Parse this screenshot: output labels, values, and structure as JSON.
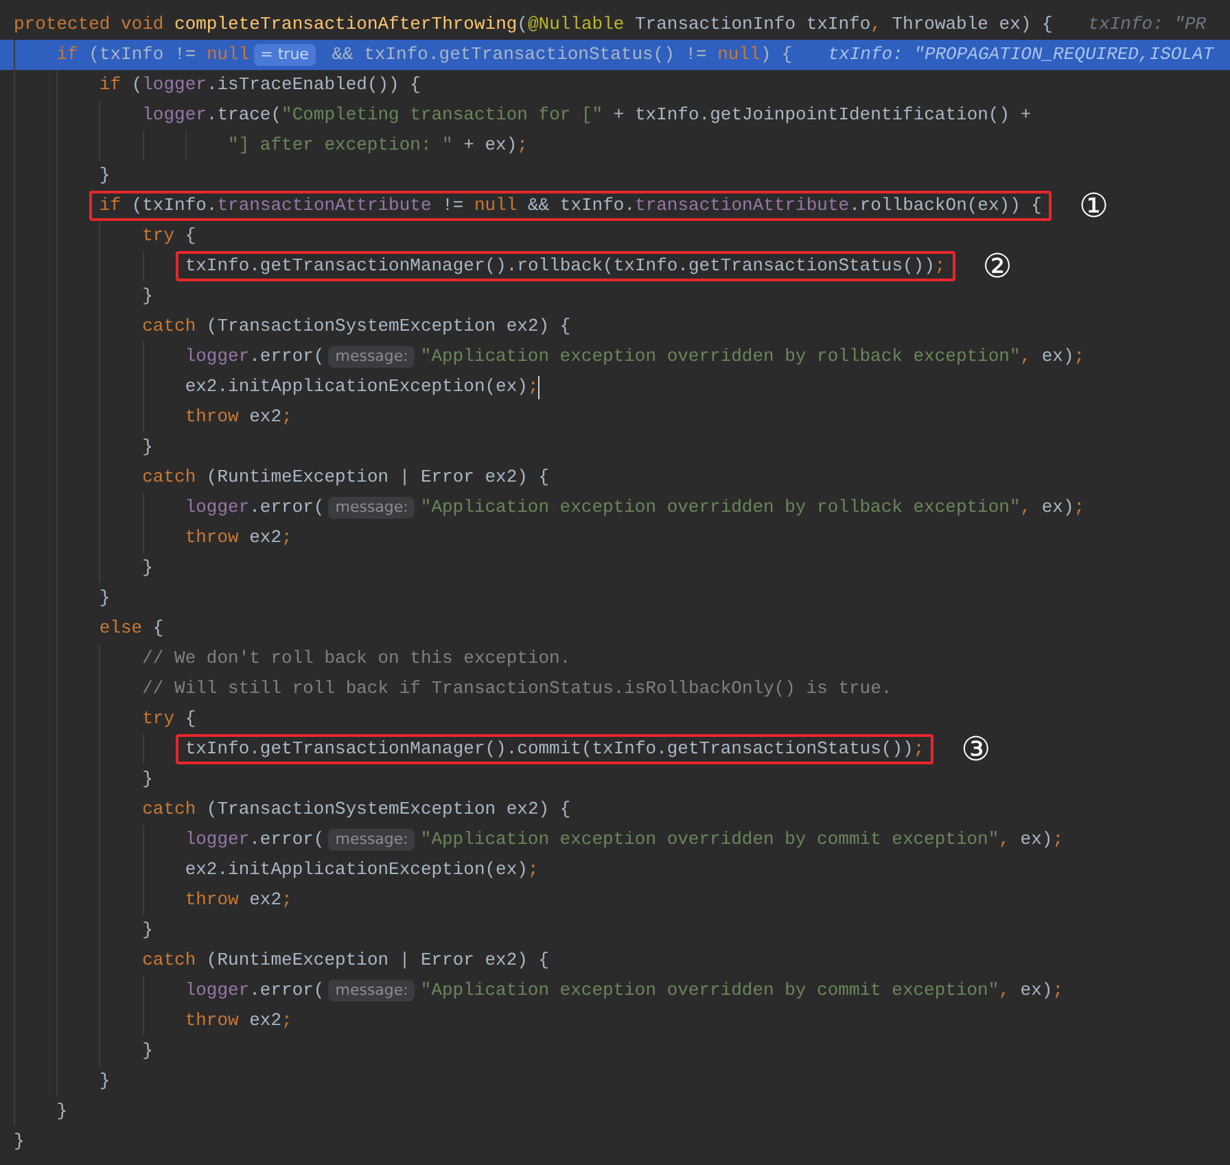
{
  "editor": {
    "lines": [
      {
        "selected": false,
        "caret": false,
        "tokens": [
          {
            "kind": "kw",
            "text": "protected void "
          },
          {
            "kind": "decl",
            "text": "completeTransactionAfterThrowing"
          },
          {
            "kind": "id",
            "text": "("
          },
          {
            "kind": "ann",
            "text": "@Nullable"
          },
          {
            "kind": "id",
            "text": " TransactionInfo txInfo"
          },
          {
            "kind": "kw",
            "text": ","
          },
          {
            "kind": "id",
            "text": " Throwable ex) {"
          },
          {
            "kind": "value",
            "text": "txInfo: \"PR"
          }
        ]
      },
      {
        "selected": true,
        "caret": false,
        "tokens": [
          {
            "kind": "kw",
            "text": "    if "
          },
          {
            "kind": "id",
            "text": "(txInfo != "
          },
          {
            "kind": "kw",
            "text": "null"
          },
          {
            "kind": "hint",
            "text": "= true"
          },
          {
            "kind": "id",
            "text": " && txInfo.getTransactionStatus() != "
          },
          {
            "kind": "kw",
            "text": "null"
          },
          {
            "kind": "id",
            "text": ") {"
          },
          {
            "kind": "value",
            "text": "txInfo: \"PROPAGATION_REQUIRED,ISOLAT"
          }
        ]
      },
      {
        "selected": false,
        "caret": false,
        "tokens": [
          {
            "kind": "kw",
            "text": "        if "
          },
          {
            "kind": "id",
            "text": "("
          },
          {
            "kind": "field",
            "text": "logger"
          },
          {
            "kind": "id",
            "text": ".isTraceEnabled()) {"
          }
        ]
      },
      {
        "selected": false,
        "caret": false,
        "tokens": [
          {
            "kind": "field",
            "text": "            logger"
          },
          {
            "kind": "id",
            "text": ".trace("
          },
          {
            "kind": "str",
            "text": "\"Completing transaction for [\""
          },
          {
            "kind": "id",
            "text": " + txInfo.getJoinpointIdentification() +"
          }
        ]
      },
      {
        "selected": false,
        "caret": false,
        "tokens": [
          {
            "kind": "str",
            "text": "                    \"] after exception: \""
          },
          {
            "kind": "id",
            "text": " + ex)"
          },
          {
            "kind": "kw",
            "text": ";"
          }
        ]
      },
      {
        "selected": false,
        "caret": false,
        "tokens": [
          {
            "kind": "id",
            "text": "        }"
          }
        ]
      },
      {
        "selected": false,
        "caret": false,
        "annotation": "①",
        "tokens": [
          {
            "kind": "kw",
            "text": "        if "
          },
          {
            "kind": "id",
            "text": "(txInfo."
          },
          {
            "kind": "field",
            "text": "transactionAttribute"
          },
          {
            "kind": "id",
            "text": " != "
          },
          {
            "kind": "kw",
            "text": "null"
          },
          {
            "kind": "id",
            "text": " && txInfo."
          },
          {
            "kind": "field",
            "text": "transactionAttribute"
          },
          {
            "kind": "id",
            "text": ".rollbackOn(ex)) {"
          }
        ]
      },
      {
        "selected": false,
        "caret": false,
        "tokens": [
          {
            "kind": "kw",
            "text": "            try "
          },
          {
            "kind": "id",
            "text": "{"
          }
        ]
      },
      {
        "selected": false,
        "caret": false,
        "annotation": "②",
        "tokens": [
          {
            "kind": "id",
            "text": "                txInfo.getTransactionManager().rollback(txInfo.getTransactionStatus())"
          },
          {
            "kind": "kw",
            "text": ";"
          }
        ]
      },
      {
        "selected": false,
        "caret": false,
        "tokens": [
          {
            "kind": "id",
            "text": "            }"
          }
        ]
      },
      {
        "selected": false,
        "caret": false,
        "tokens": [
          {
            "kind": "kw",
            "text": "            catch "
          },
          {
            "kind": "id",
            "text": "(TransactionSystemException ex2) {"
          }
        ]
      },
      {
        "selected": false,
        "caret": false,
        "tokens": [
          {
            "kind": "field",
            "text": "                logger"
          },
          {
            "kind": "id",
            "text": ".error("
          },
          {
            "kind": "hint",
            "text": "message:"
          },
          {
            "kind": "str",
            "text": "\"Application exception overridden by rollback exception\""
          },
          {
            "kind": "kw",
            "text": ","
          },
          {
            "kind": "id",
            "text": " ex)"
          },
          {
            "kind": "kw",
            "text": ";"
          }
        ]
      },
      {
        "selected": false,
        "caret": true,
        "tokens": [
          {
            "kind": "id",
            "text": "                ex2.initApplicationException(ex)"
          },
          {
            "kind": "kw",
            "text": ";"
          }
        ]
      },
      {
        "selected": false,
        "caret": false,
        "tokens": [
          {
            "kind": "kw",
            "text": "                throw "
          },
          {
            "kind": "id",
            "text": "ex2"
          },
          {
            "kind": "kw",
            "text": ";"
          }
        ]
      },
      {
        "selected": false,
        "caret": false,
        "tokens": [
          {
            "kind": "id",
            "text": "            }"
          }
        ]
      },
      {
        "selected": false,
        "caret": false,
        "tokens": [
          {
            "kind": "kw",
            "text": "            catch "
          },
          {
            "kind": "id",
            "text": "(RuntimeException | Error ex2) {"
          }
        ]
      },
      {
        "selected": false,
        "caret": false,
        "tokens": [
          {
            "kind": "field",
            "text": "                logger"
          },
          {
            "kind": "id",
            "text": ".error("
          },
          {
            "kind": "hint",
            "text": "message:"
          },
          {
            "kind": "str",
            "text": "\"Application exception overridden by rollback exception\""
          },
          {
            "kind": "kw",
            "text": ","
          },
          {
            "kind": "id",
            "text": " ex)"
          },
          {
            "kind": "kw",
            "text": ";"
          }
        ]
      },
      {
        "selected": false,
        "caret": false,
        "tokens": [
          {
            "kind": "kw",
            "text": "                throw "
          },
          {
            "kind": "id",
            "text": "ex2"
          },
          {
            "kind": "kw",
            "text": ";"
          }
        ]
      },
      {
        "selected": false,
        "caret": false,
        "tokens": [
          {
            "kind": "id",
            "text": "            }"
          }
        ]
      },
      {
        "selected": false,
        "caret": false,
        "tokens": [
          {
            "kind": "id",
            "text": "        }"
          }
        ]
      },
      {
        "selected": false,
        "caret": false,
        "tokens": [
          {
            "kind": "kw",
            "text": "        else "
          },
          {
            "kind": "id",
            "text": "{"
          }
        ]
      },
      {
        "selected": false,
        "caret": false,
        "tokens": [
          {
            "kind": "comment",
            "text": "            // We don't roll back on this exception."
          }
        ]
      },
      {
        "selected": false,
        "caret": false,
        "tokens": [
          {
            "kind": "comment",
            "text": "            // Will still roll back if TransactionStatus.isRollbackOnly() is true."
          }
        ]
      },
      {
        "selected": false,
        "caret": false,
        "tokens": [
          {
            "kind": "kw",
            "text": "            try "
          },
          {
            "kind": "id",
            "text": "{"
          }
        ]
      },
      {
        "selected": false,
        "caret": false,
        "annotation": "③",
        "tokens": [
          {
            "kind": "id",
            "text": "                txInfo.getTransactionManager().commit(txInfo.getTransactionStatus())"
          },
          {
            "kind": "kw",
            "text": ";"
          }
        ]
      },
      {
        "selected": false,
        "caret": false,
        "tokens": [
          {
            "kind": "id",
            "text": "            }"
          }
        ]
      },
      {
        "selected": false,
        "caret": false,
        "tokens": [
          {
            "kind": "kw",
            "text": "            catch "
          },
          {
            "kind": "id",
            "text": "(TransactionSystemException ex2) {"
          }
        ]
      },
      {
        "selected": false,
        "caret": false,
        "tokens": [
          {
            "kind": "field",
            "text": "                logger"
          },
          {
            "kind": "id",
            "text": ".error("
          },
          {
            "kind": "hint",
            "text": "message:"
          },
          {
            "kind": "str",
            "text": "\"Application exception overridden by commit exception\""
          },
          {
            "kind": "kw",
            "text": ","
          },
          {
            "kind": "id",
            "text": " ex)"
          },
          {
            "kind": "kw",
            "text": ";"
          }
        ]
      },
      {
        "selected": false,
        "caret": false,
        "tokens": [
          {
            "kind": "id",
            "text": "                ex2.initApplicationException(ex)"
          },
          {
            "kind": "kw",
            "text": ";"
          }
        ]
      },
      {
        "selected": false,
        "caret": false,
        "tokens": [
          {
            "kind": "kw",
            "text": "                throw "
          },
          {
            "kind": "id",
            "text": "ex2"
          },
          {
            "kind": "kw",
            "text": ";"
          }
        ]
      },
      {
        "selected": false,
        "caret": false,
        "tokens": [
          {
            "kind": "id",
            "text": "            }"
          }
        ]
      },
      {
        "selected": false,
        "caret": false,
        "tokens": [
          {
            "kind": "kw",
            "text": "            catch "
          },
          {
            "kind": "id",
            "text": "(RuntimeException | Error ex2) {"
          }
        ]
      },
      {
        "selected": false,
        "caret": false,
        "tokens": [
          {
            "kind": "field",
            "text": "                logger"
          },
          {
            "kind": "id",
            "text": ".error("
          },
          {
            "kind": "hint",
            "text": "message:"
          },
          {
            "kind": "str",
            "text": "\"Application exception overridden by commit exception\""
          },
          {
            "kind": "kw",
            "text": ","
          },
          {
            "kind": "id",
            "text": " ex)"
          },
          {
            "kind": "kw",
            "text": ";"
          }
        ]
      },
      {
        "selected": false,
        "caret": false,
        "tokens": [
          {
            "kind": "kw",
            "text": "                throw "
          },
          {
            "kind": "id",
            "text": "ex2"
          },
          {
            "kind": "kw",
            "text": ";"
          }
        ]
      },
      {
        "selected": false,
        "caret": false,
        "tokens": [
          {
            "kind": "id",
            "text": "            }"
          }
        ]
      },
      {
        "selected": false,
        "caret": false,
        "tokens": [
          {
            "kind": "id",
            "text": "        }"
          }
        ]
      },
      {
        "selected": false,
        "caret": false,
        "tokens": [
          {
            "kind": "id",
            "text": "    }"
          }
        ]
      },
      {
        "selected": false,
        "caret": false,
        "tokens": [
          {
            "kind": "id",
            "text": "}"
          }
        ]
      }
    ]
  }
}
